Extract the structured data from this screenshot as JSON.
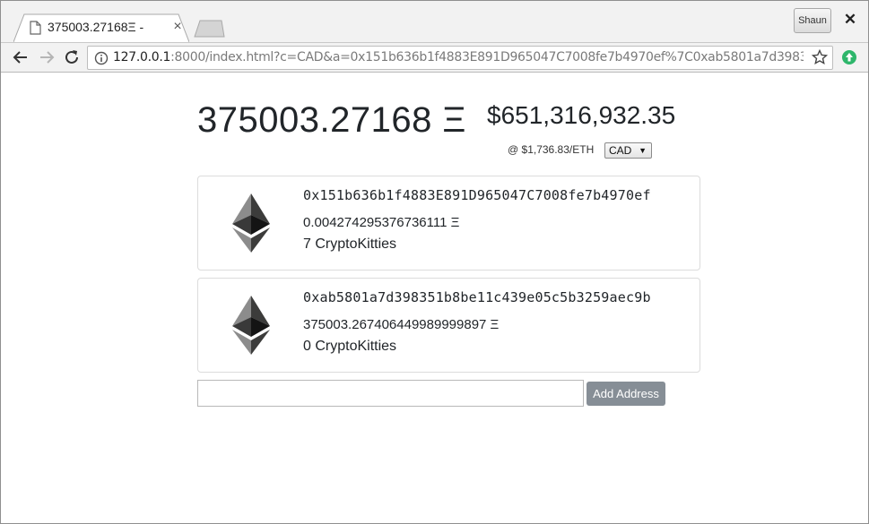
{
  "browser": {
    "tab_title": "375003.27168Ξ - ",
    "tab_close": "×",
    "profile_label": "Shaun",
    "window_close": "✕",
    "url_host": "127.0.0.1",
    "url_rest": ":8000/index.html?c=CAD&a=0x151b636b1f4883E891D965047C7008fe7b4970ef%7C0xab5801a7d398351b8be..."
  },
  "summary": {
    "eth_total": "375003.27168 Ξ",
    "fiat_total": "$651,316,932.35",
    "rate": "@ $1,736.83/ETH",
    "currency": "CAD"
  },
  "wallets": [
    {
      "address": "0x151b636b1f4883E891D965047C7008fe7b4970ef",
      "balance": "0.004274295376736111 Ξ",
      "kitties": "7 CryptoKitties"
    },
    {
      "address": "0xab5801a7d398351b8be11c439e05c5b3259aec9b",
      "balance": "375003.267406449989999897 Ξ",
      "kitties": "0 CryptoKitties"
    }
  ],
  "form": {
    "input_value": "",
    "add_button": "Add Address"
  },
  "icons": [
    "page-icon",
    "back-icon",
    "forward-icon",
    "reload-icon",
    "info-icon",
    "star-icon",
    "extension-icon",
    "ethereum-logo-icon"
  ],
  "colors": {
    "button_bg": "#868e96",
    "text": "#212529",
    "card_border": "#dcdcdc",
    "extension_green": "#2eb66b"
  }
}
